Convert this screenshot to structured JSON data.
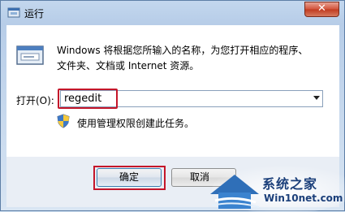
{
  "window": {
    "title": "运行",
    "close_glyph": "✕"
  },
  "content": {
    "description_line1": "Windows 将根据您所输入的名称，为您打开相应的程序、",
    "description_line2": "文件夹、文档或 Internet 资源。",
    "open_label": "打开(O):",
    "open_value": "regedit",
    "admin_note": "使用管理权限创建此任务。"
  },
  "buttons": {
    "ok_label": "确定",
    "cancel_label": "取消"
  },
  "watermark": {
    "title": "系统之家",
    "site": "Win10net.com"
  },
  "icons": {
    "title": "run-icon",
    "app": "run-program-icon",
    "shield": "uac-shield-icon",
    "watermark": "house-logo-icon"
  },
  "colors": {
    "highlight": "#c4162a",
    "close_button": "#c94a30",
    "watermark_text": "#1b3f7a"
  }
}
